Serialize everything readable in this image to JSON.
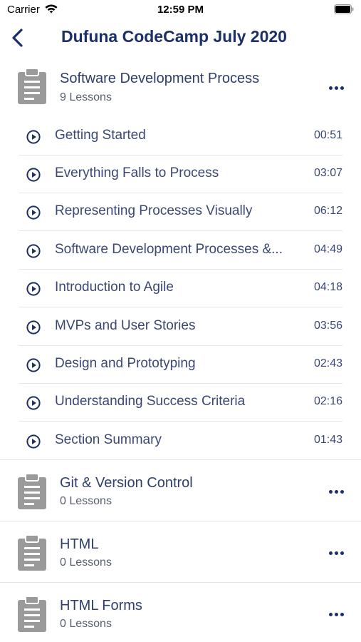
{
  "status_bar": {
    "carrier": "Carrier",
    "time": "12:59 PM"
  },
  "nav": {
    "title": "Dufuna CodeCamp July 2020"
  },
  "sections": [
    {
      "name": "Software Development Process",
      "count": "9 Lessons"
    },
    {
      "name": "Git & Version Control",
      "count": "0 Lessons"
    },
    {
      "name": "HTML",
      "count": "0 Lessons"
    },
    {
      "name": "HTML Forms",
      "count": "0 Lessons"
    }
  ],
  "lessons": [
    {
      "title": "Getting Started",
      "duration": "00:51"
    },
    {
      "title": "Everything Falls to Process",
      "duration": "03:07"
    },
    {
      "title": "Representing Processes Visually",
      "duration": "06:12"
    },
    {
      "title": "Software Development Processes &...",
      "duration": "04:49"
    },
    {
      "title": "Introduction to Agile",
      "duration": "04:18"
    },
    {
      "title": "MVPs and User Stories",
      "duration": "03:56"
    },
    {
      "title": "Design and Prototyping",
      "duration": "02:43"
    },
    {
      "title": "Understanding Success Criteria",
      "duration": "02:16"
    },
    {
      "title": "Section Summary",
      "duration": "01:43"
    }
  ],
  "icons": {
    "back": "chevron-left-icon",
    "section": "clipboard-icon",
    "lesson": "play-circle-icon",
    "more": "more-horizontal-icon"
  },
  "colors": {
    "accent": "#1b2f68",
    "text": "#2f3e6b",
    "icon_gray": "#9a9a9a"
  }
}
